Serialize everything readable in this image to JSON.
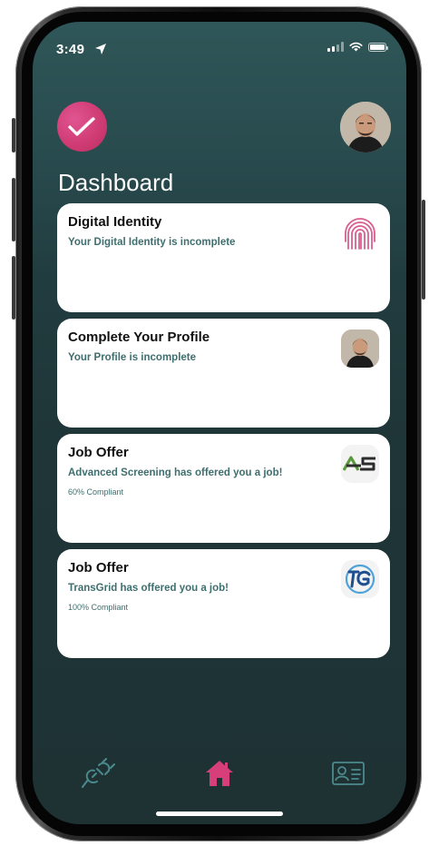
{
  "status_bar": {
    "time": "3:49"
  },
  "header": {
    "title": "Dashboard"
  },
  "cards": [
    {
      "title": "Digital Identity",
      "subtitle": "Your Digital Identity is incomplete",
      "note": "",
      "icon": "fingerprint-icon"
    },
    {
      "title": "Complete Your Profile",
      "subtitle": "Your Profile is incomplete",
      "note": "",
      "icon": "profile-avatar"
    },
    {
      "title": "Job Offer",
      "subtitle": "Advanced Screening has offered you a job!",
      "note": "60% Compliant",
      "icon": "as-logo",
      "logo_text": "AS"
    },
    {
      "title": "Job Offer",
      "subtitle": "TransGrid has offered you a job!",
      "note": "100% Compliant",
      "icon": "tg-logo",
      "logo_text": "TG"
    }
  ],
  "tab_bar": {
    "items": [
      {
        "icon": "plug-connect-icon",
        "active": false
      },
      {
        "icon": "home-icon",
        "active": true
      },
      {
        "icon": "id-card-icon",
        "active": false
      }
    ]
  },
  "colors": {
    "accent": "#d63f7a",
    "subtitle_teal": "#3f6e6e",
    "background_top": "#2f5658",
    "background_bottom": "#1e3234"
  }
}
